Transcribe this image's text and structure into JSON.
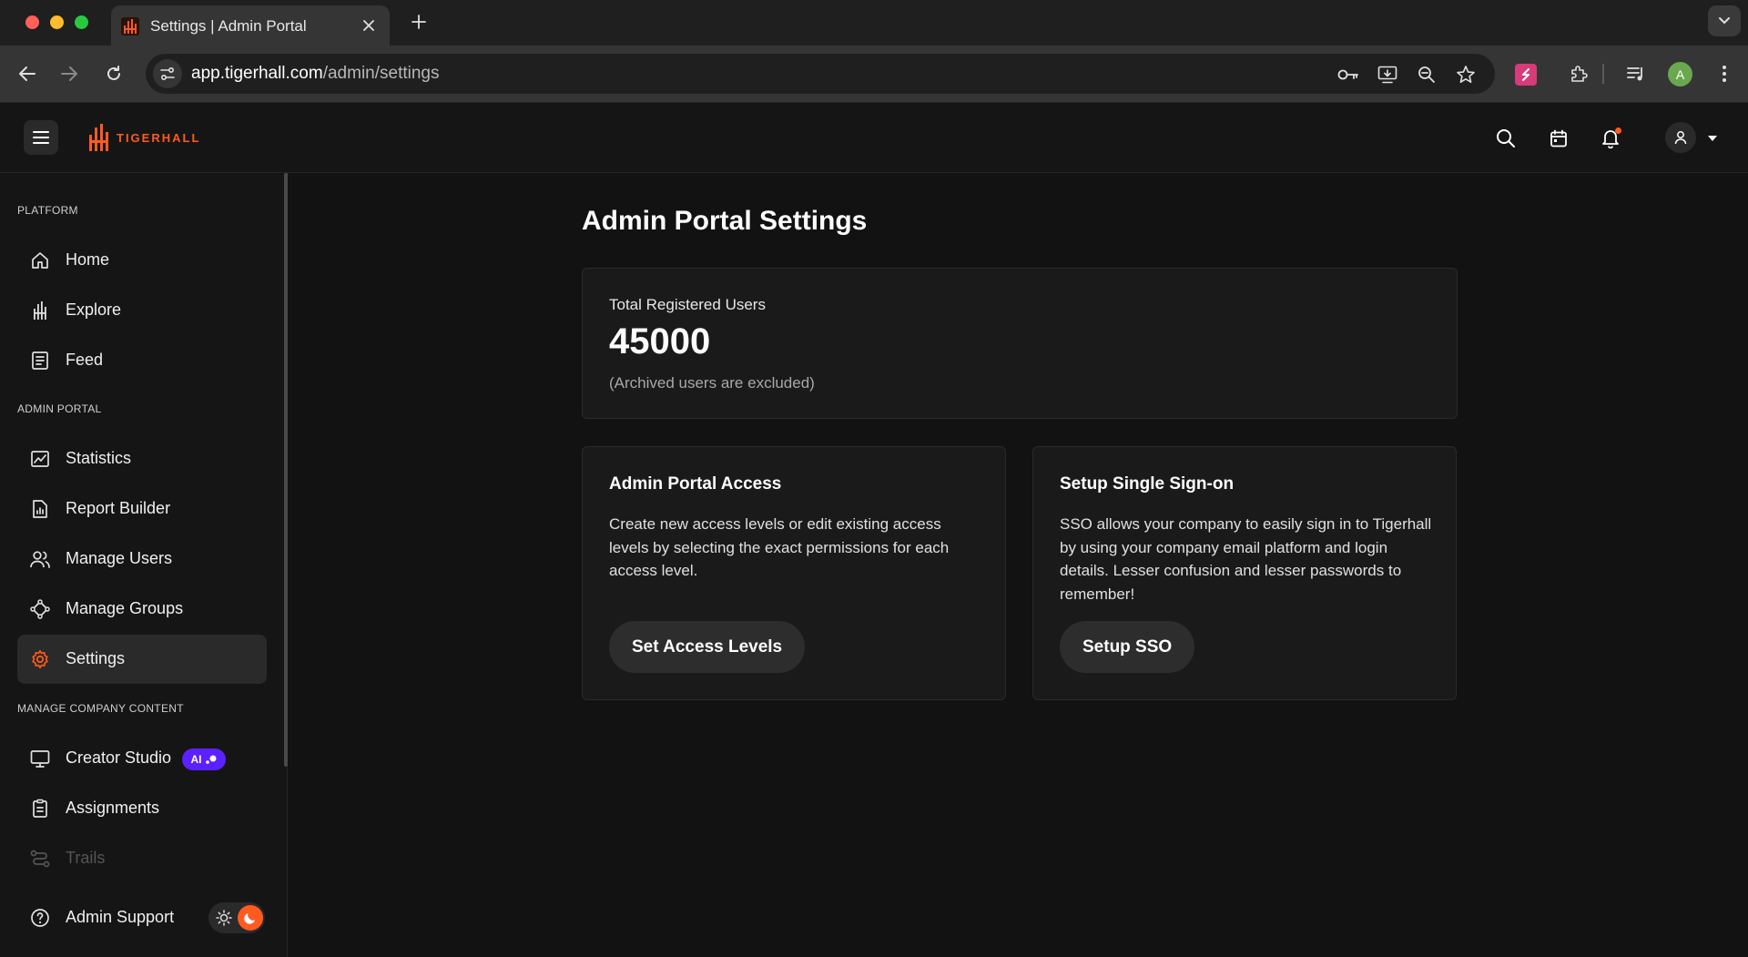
{
  "browser": {
    "tab_title": "Settings | Admin Portal",
    "url_host": "app.tigerhall.com",
    "url_path": "/admin/settings",
    "profile_initial": "A"
  },
  "header": {
    "logo_text": "TIGERHALL",
    "brand_color": "#ff5a1f"
  },
  "sidebar": {
    "sections": [
      {
        "label": "PLATFORM"
      },
      {
        "label": "ADMIN PORTAL"
      },
      {
        "label": "MANAGE COMPANY CONTENT"
      }
    ],
    "items": [
      {
        "label": "Home",
        "icon": "home-icon"
      },
      {
        "label": "Explore",
        "icon": "tigerhall-mark-icon"
      },
      {
        "label": "Feed",
        "icon": "feed-icon"
      },
      {
        "label": "Statistics",
        "icon": "chart-icon"
      },
      {
        "label": "Report Builder",
        "icon": "report-icon"
      },
      {
        "label": "Manage Users",
        "icon": "users-icon"
      },
      {
        "label": "Manage Groups",
        "icon": "groups-icon"
      },
      {
        "label": "Settings",
        "icon": "gear-icon",
        "active": true
      },
      {
        "label": "Creator Studio",
        "icon": "monitor-icon",
        "badge": "AI"
      },
      {
        "label": "Assignments",
        "icon": "clipboard-icon"
      },
      {
        "label": "Trails",
        "icon": "trail-icon",
        "disabled": true
      },
      {
        "label": "Admin Support",
        "icon": "help-icon"
      }
    ]
  },
  "main": {
    "title": "Admin Portal Settings",
    "stats": {
      "label": "Total Registered Users",
      "value": "45000",
      "note": "(Archived users are excluded)"
    },
    "cards": [
      {
        "title": "Admin Portal Access",
        "description": "Create new access levels or edit existing access levels by selecting the exact permissions for each access level.",
        "button": "Set Access Levels"
      },
      {
        "title": "Setup Single Sign-on",
        "description": "SSO allows your company to easily sign in to Tigerhall by using your company email platform and login details. Lesser confusion and lesser passwords to remember!",
        "button": "Setup SSO"
      }
    ]
  }
}
